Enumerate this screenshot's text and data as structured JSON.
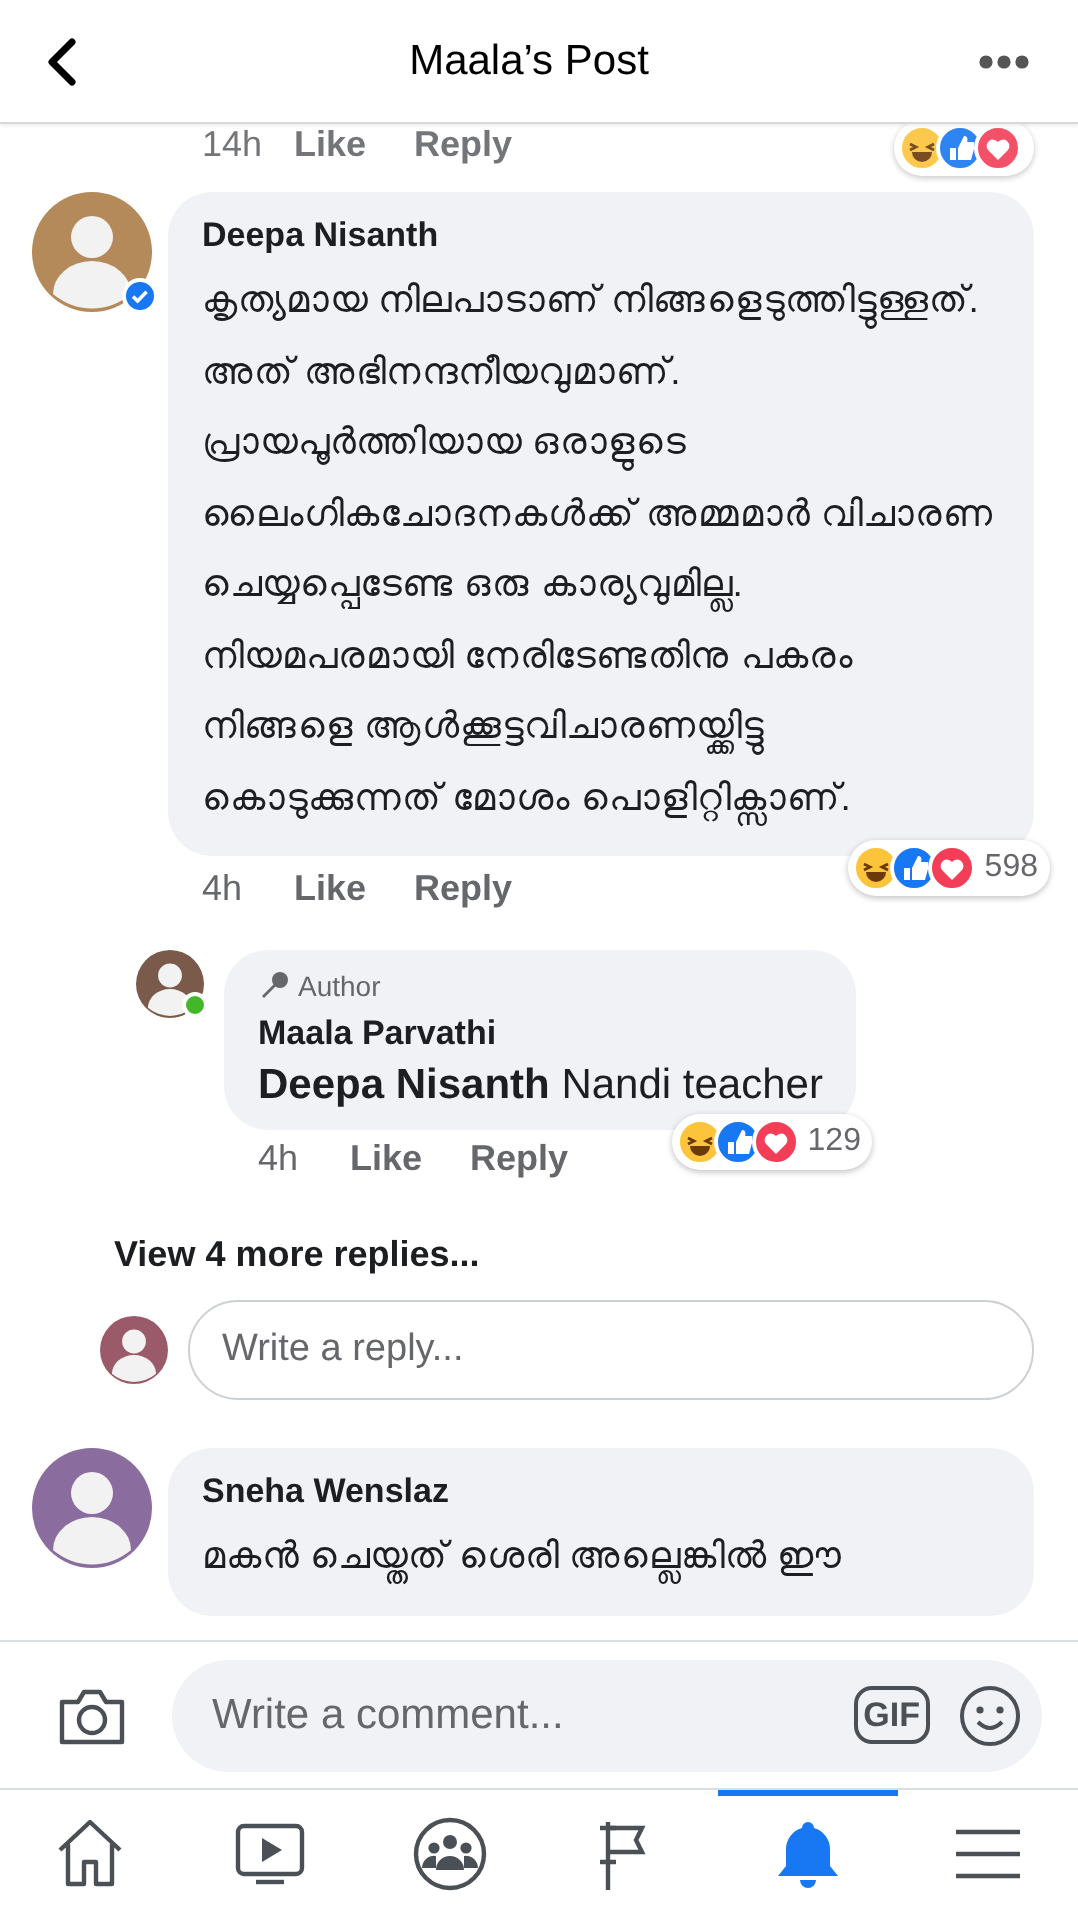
{
  "header": {
    "title": "Maala’s Post"
  },
  "previous_comment_actions": {
    "time": "14h",
    "like": "Like",
    "reply": "Reply"
  },
  "comments": [
    {
      "author": "Deepa Nisanth",
      "verified": true,
      "online": false,
      "text": "കൃത്യമായ നിലപാടാണ് നിങ്ങളെടുത്തിട്ടുള്ളത്. അത് അഭിനന്ദനീയവുമാണ്. പ്രായപൂർത്തിയായ ഒരാളുടെ ലൈംഗികചോദനകൾക്ക് അമ്മമാർ വിചാരണ ചെയ്യപ്പെടേണ്ട ഒരു കാര്യവുമില്ല. നിയമപരമായി നേരിടേണ്ടതിനു പകരം നിങ്ങളെ ആൾക്കൂട്ടവിചാരണയ്ക്കിട്ടു കൊടുക്കുന്നത് മോശം പൊളിറ്റിക്സാണ്.",
      "time": "4h",
      "like": "Like",
      "reply": "Reply",
      "reaction_count": "598",
      "replies": [
        {
          "badge": "Author",
          "author": "Maala Parvathi",
          "verified": false,
          "online": true,
          "text": "**Deepa Nisanth** Nandi teacher",
          "time": "4h",
          "like": "Like",
          "reply": "Reply",
          "reaction_count": "129"
        }
      ],
      "more_replies": "View 4 more replies...",
      "reply_field": {
        "placeholder": "Write a reply..."
      }
    },
    {
      "author": "Sneha Wenslaz",
      "verified": false,
      "online": false,
      "text": "മകൻ ചെയ്തത് ശെരി അല്ലെങ്കിൽ ഈ"
    }
  ],
  "composer": {
    "placeholder": "Write a comment...",
    "gif": "GIF"
  },
  "tabs": [
    {
      "kind": "home",
      "selected": false
    },
    {
      "kind": "video",
      "selected": false
    },
    {
      "kind": "groups",
      "selected": false
    },
    {
      "kind": "pages",
      "selected": false
    },
    {
      "kind": "notifications",
      "selected": true
    },
    {
      "kind": "menu",
      "selected": false
    }
  ]
}
